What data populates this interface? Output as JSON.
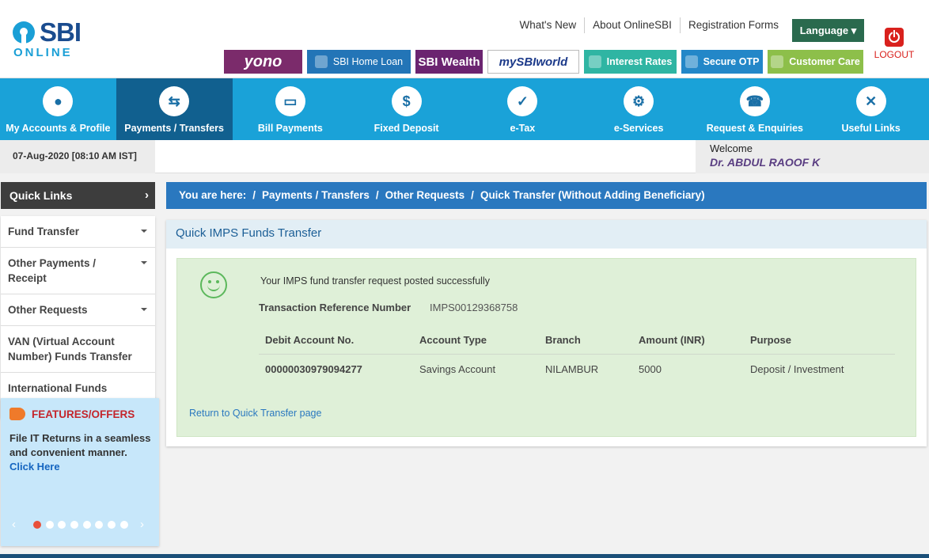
{
  "brand": {
    "sbi": "SBI",
    "online": "ONLINE"
  },
  "top_links": [
    "What's New",
    "About OnlineSBI",
    "Registration Forms"
  ],
  "language_label": "Language",
  "logout_label": "LOGOUT",
  "banners": {
    "yono": "yono",
    "home_loan": "SBI Home Loan",
    "wealth": "SBI Wealth",
    "myworld": "mySBIworld",
    "interest_rates": "Interest Rates",
    "secure_otp": "Secure OTP",
    "customer_care": "Customer Care"
  },
  "nav": [
    {
      "label": "My Accounts & Profile",
      "icon": "user-icon",
      "glyph": "●"
    },
    {
      "label": "Payments / Transfers",
      "icon": "transfer-icon",
      "glyph": "⇆"
    },
    {
      "label": "Bill Payments",
      "icon": "card-icon",
      "glyph": "▭"
    },
    {
      "label": "Fixed Deposit",
      "icon": "deposit-icon",
      "glyph": "$"
    },
    {
      "label": "e-Tax",
      "icon": "tax-icon",
      "glyph": "✓"
    },
    {
      "label": "e-Services",
      "icon": "services-icon",
      "glyph": "⚙"
    },
    {
      "label": "Request & Enquiries",
      "icon": "phone-icon",
      "glyph": "☎"
    },
    {
      "label": "Useful Links",
      "icon": "links-icon",
      "glyph": "✕"
    }
  ],
  "datetime": "07-Aug-2020 [08:10 AM IST]",
  "welcome": {
    "label": "Welcome",
    "name": "Dr. ABDUL RAOOF K"
  },
  "quick_links": {
    "title": "Quick Links",
    "items": [
      "Fund Transfer",
      "Other Payments / Receipt",
      "Other Requests",
      "VAN (Virtual Account Number) Funds Transfer",
      "International Funds Transfer"
    ]
  },
  "offers": {
    "title": "FEATURES/OFFERS",
    "text": "File IT Returns in a seamless and convenient manner.",
    "link": "Click Here"
  },
  "breadcrumb": [
    "You are here:",
    "/",
    "Payments / Transfers",
    "/",
    "Other Requests",
    "/",
    "Quick Transfer (Without Adding Beneficiary)"
  ],
  "panel": {
    "title": "Quick IMPS Funds Transfer",
    "message": "Your IMPS fund transfer request posted successfully",
    "ref_label": "Transaction Reference Number",
    "ref_value": "IMPS00129368758",
    "columns": [
      "Debit Account No.",
      "Account Type",
      "Branch",
      "Amount (INR)",
      "Purpose"
    ],
    "row": [
      "00000030979094277",
      "Savings Account",
      "NILAMBUR",
      "5000",
      "Deposit / Investment"
    ],
    "return_link": "Return to Quick Transfer page"
  },
  "colors": {
    "nav": "#1aa2d8",
    "nav_active": "#11608f",
    "success_bg": "#dff0d8",
    "breadcrumb": "#2a78bf"
  }
}
